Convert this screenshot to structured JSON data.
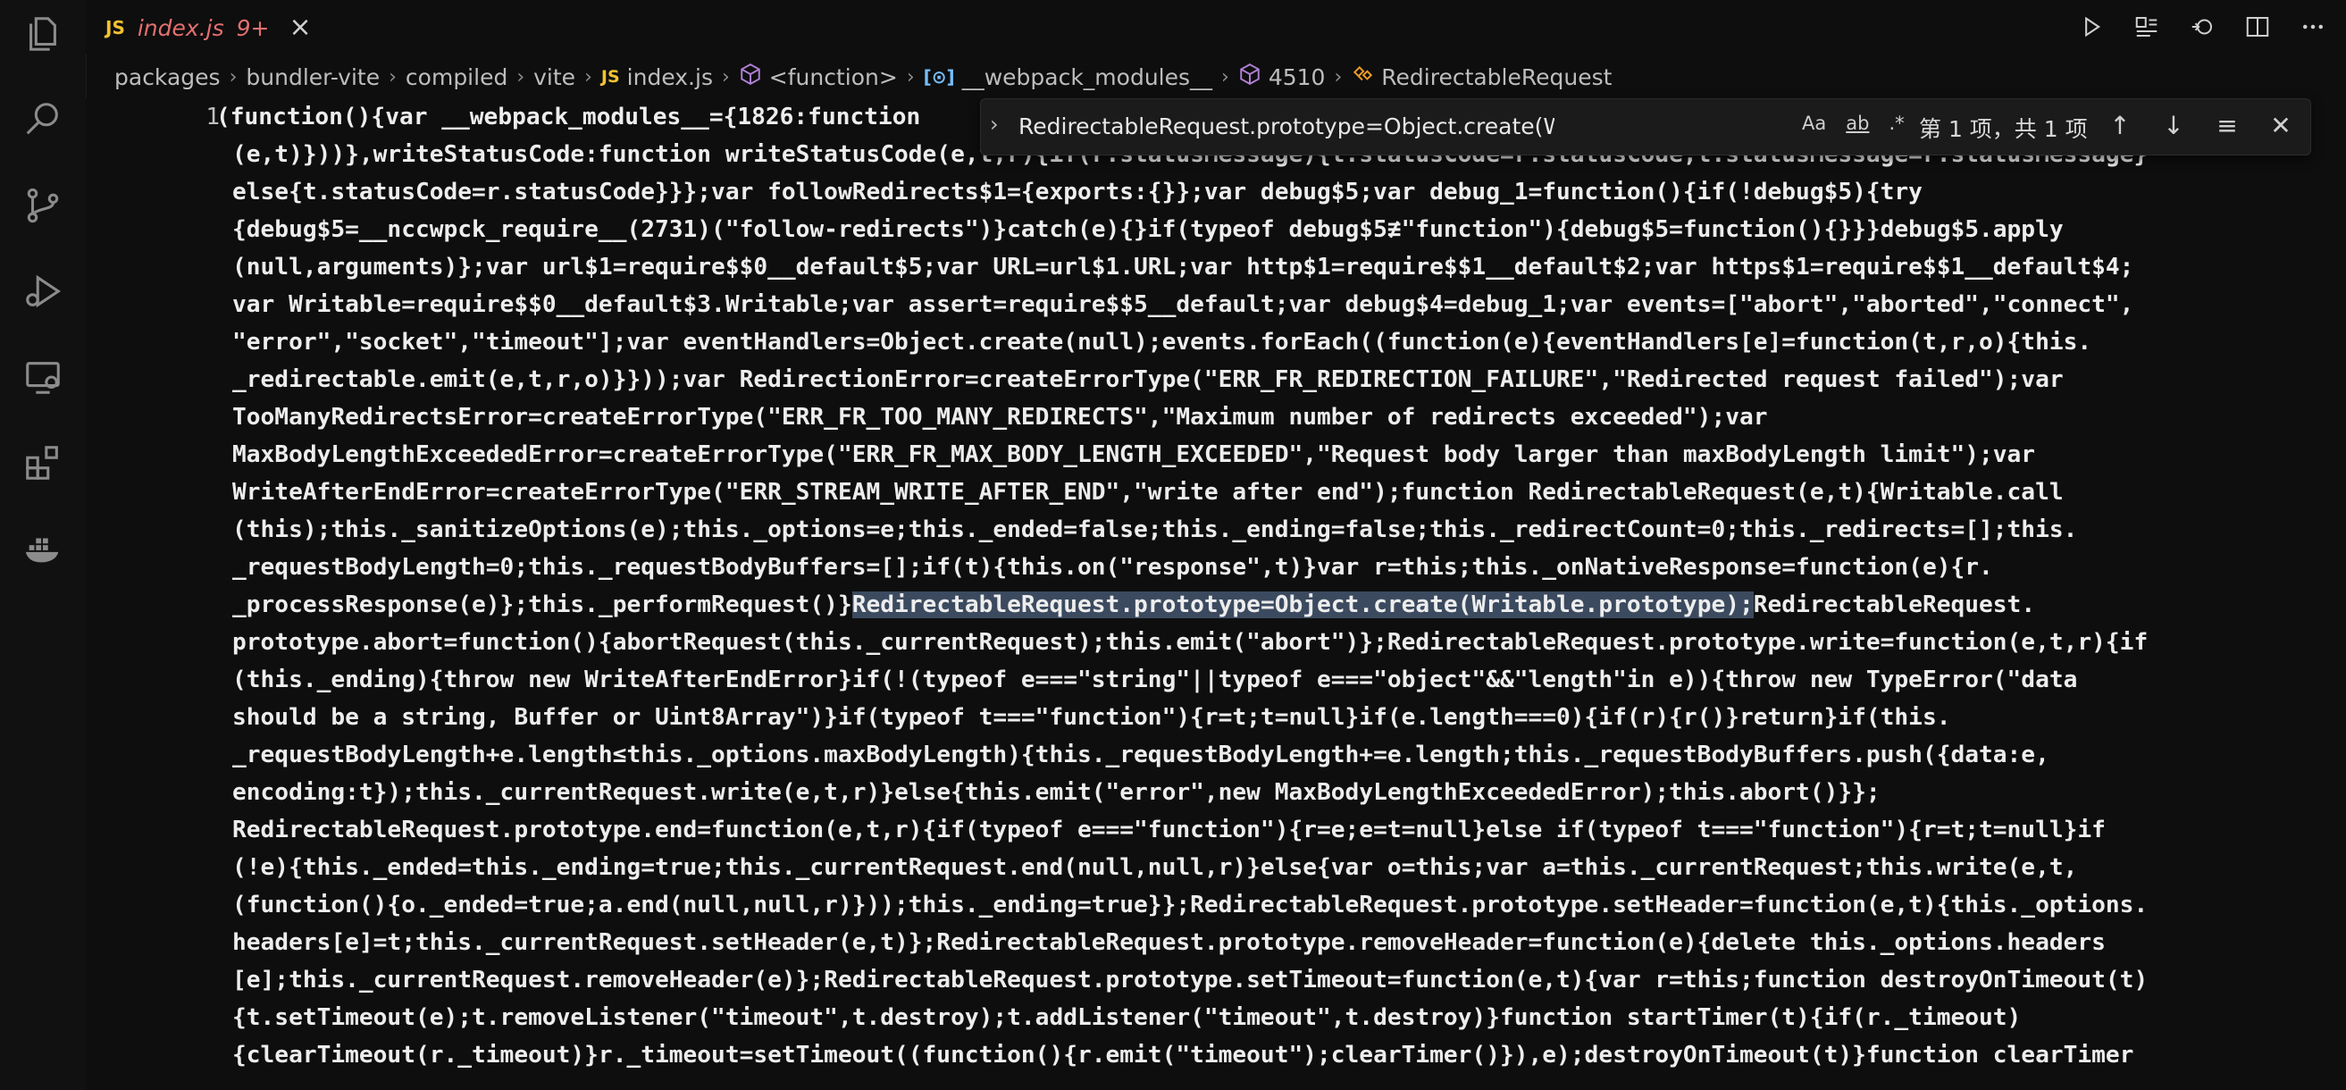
{
  "tab": {
    "badge": "JS",
    "name": "index.js",
    "problems": "9+",
    "close": "×"
  },
  "breadcrumb": {
    "items": [
      "packages",
      "bundler-vite",
      "compiled",
      "vite",
      "index.js",
      "<function>",
      "__webpack_modules__",
      "4510",
      "RedirectableRequest"
    ],
    "js_badge": "JS",
    "sep": "›"
  },
  "find": {
    "query": "RedirectableRequest.prototype=Object.create(Writable.prototype);",
    "match_case": "Aa",
    "whole_word": "ab",
    "regex": ".*",
    "result": "第 1 项，共 1 项",
    "expand": "›"
  },
  "editor": {
    "line_number": "1",
    "code_lines": [
      "(function(){var __webpack_modules__={1826:function",
      "(e,t)}))},writeStatusCode:function writeStatusCode(e,t,r){if(r.statusMessage){t.statusCode=r.statusCode;t.statusMessage=r.statusMessage}",
      "else{t.statusCode=r.statusCode}}};var followRedirects$1={exports:{}};var debug$5;var debug_1=function(){if(!debug$5){try",
      "{debug$5=__nccwpck_require__(2731)(\"follow-redirects\")}catch(e){}if(typeof debug$5≢\"function\"){debug$5=function(){}}}debug$5.apply",
      "(null,arguments)};var url$1=require$$0__default$5;var URL=url$1.URL;var http$1=require$$1__default$2;var https$1=require$$1__default$4;",
      "var Writable=require$$0__default$3.Writable;var assert=require$$5__default;var debug$4=debug_1;var events=[\"abort\",\"aborted\",\"connect\",",
      "\"error\",\"socket\",\"timeout\"];var eventHandlers=Object.create(null);events.forEach((function(e){eventHandlers[e]=function(t,r,o){this.",
      "_redirectable.emit(e,t,r,o)}}));var RedirectionError=createErrorType(\"ERR_FR_REDIRECTION_FAILURE\",\"Redirected request failed\");var",
      "TooManyRedirectsError=createErrorType(\"ERR_FR_TOO_MANY_REDIRECTS\",\"Maximum number of redirects exceeded\");var",
      "MaxBodyLengthExceededError=createErrorType(\"ERR_FR_MAX_BODY_LENGTH_EXCEEDED\",\"Request body larger than maxBodyLength limit\");var",
      "WriteAfterEndError=createErrorType(\"ERR_STREAM_WRITE_AFTER_END\",\"write after end\");function RedirectableRequest(e,t){Writable.call",
      "(this);this._sanitizeOptions(e);this._options=e;this._ended=false;this._ending=false;this._redirectCount=0;this._redirects=[];this.",
      "_requestBodyLength=0;this._requestBodyBuffers=[];if(t){this.on(\"response\",t)}var r=this;this._onNativeResponse=function(e){r.",
      "_processResponse(e)};this._performRequest()}",
      "prototype.abort=function(){abortRequest(this._currentRequest);this.emit(\"abort\")};RedirectableRequest.prototype.write=function(e,t,r){if",
      "(this._ending){throw new WriteAfterEndError}if(!(typeof e===\"string\"||typeof e===\"object\"&&\"length\"in e)){throw new TypeError(\"data",
      "should be a string, Buffer or Uint8Array\")}if(typeof t===\"function\"){r=t;t=null}if(e.length===0){if(r){r()}return}if(this.",
      "_requestBodyLength+e.length≤this._options.maxBodyLength){this._requestBodyLength+=e.length;this._requestBodyBuffers.push({data:e,",
      "encoding:t});this._currentRequest.write(e,t,r)}else{this.emit(\"error\",new MaxBodyLengthExceededError);this.abort()}};",
      "RedirectableRequest.prototype.end=function(e,t,r){if(typeof e===\"function\"){r=e;e=t=null}else if(typeof t===\"function\"){r=t;t=null}if",
      "(!e){this._ended=this._ending=true;this._currentRequest.end(null,null,r)}else{var o=this;var a=this._currentRequest;this.write(e,t,",
      "(function(){o._ended=true;a.end(null,null,r)}));this._ending=true}};RedirectableRequest.prototype.setHeader=function(e,t){this._options.",
      "headers[e]=t;this._currentRequest.setHeader(e,t)};RedirectableRequest.prototype.removeHeader=function(e){delete this._options.headers",
      "[e];this._currentRequest.removeHeader(e)};RedirectableRequest.prototype.setTimeout=function(e,t){var r=this;function destroyOnTimeout(t)",
      "{t.setTimeout(e);t.removeListener(\"timeout\",t.destroy);t.addListener(\"timeout\",t.destroy)}function startTimer(t){if(r._timeout)",
      "{clearTimeout(r._timeout)}r._timeout=setTimeout((function(){r.emit(\"timeout\");clearTimer()}),e);destroyOnTimeout(t)}function clearTimer"
    ],
    "highlight": "RedirectableRequest.prototype=Object.create(Writable.prototype);",
    "after_highlight": "RedirectableRequest."
  }
}
